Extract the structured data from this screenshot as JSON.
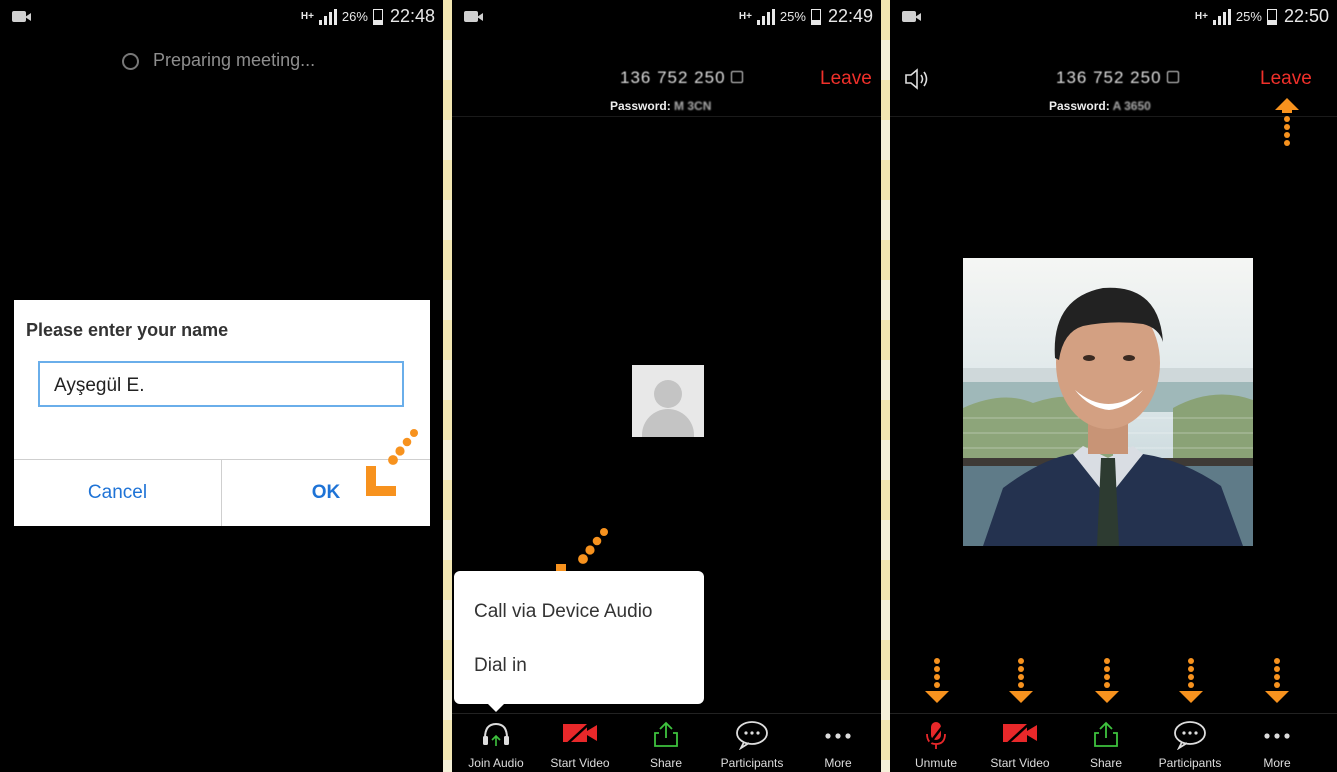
{
  "colors": {
    "accent_orange": "#f7921e",
    "leave_red": "#f0302a",
    "link_blue": "#1e73d6",
    "input_border": "#6aaeea"
  },
  "screens": [
    {
      "status": {
        "network": "H+",
        "battery": "26%",
        "time": "22:48"
      },
      "preparing_text": "Preparing meeting...",
      "dialog": {
        "title": "Please enter your name",
        "name_value": "Ayşegül E.",
        "cancel_label": "Cancel",
        "ok_label": "OK"
      }
    },
    {
      "status": {
        "network": "H+",
        "battery": "25%",
        "time": "22:49"
      },
      "meeting_id": "136 752 250",
      "password_label": "Password:",
      "password_value": "M 3CN",
      "leave_label": "Leave",
      "audio_menu": {
        "items": [
          "Call via Device Audio",
          "Dial in"
        ]
      },
      "toolbar": [
        {
          "label": "Join Audio",
          "icon": "headphone-icon"
        },
        {
          "label": "Start Video",
          "icon": "video-off-icon"
        },
        {
          "label": "Share",
          "icon": "share-icon"
        },
        {
          "label": "Participants",
          "icon": "chat-bubble-icon"
        },
        {
          "label": "More",
          "icon": "more-dots-icon"
        }
      ]
    },
    {
      "status": {
        "network": "H+",
        "battery": "25%",
        "time": "22:50"
      },
      "meeting_id": "136 752 250",
      "password_label": "Password:",
      "password_value": "A 3650",
      "leave_label": "Leave",
      "toolbar": [
        {
          "label": "Unmute",
          "icon": "mic-off-icon"
        },
        {
          "label": "Start Video",
          "icon": "video-off-icon"
        },
        {
          "label": "Share",
          "icon": "share-icon"
        },
        {
          "label": "Participants",
          "icon": "chat-bubble-icon"
        },
        {
          "label": "More",
          "icon": "more-dots-icon"
        }
      ]
    }
  ]
}
